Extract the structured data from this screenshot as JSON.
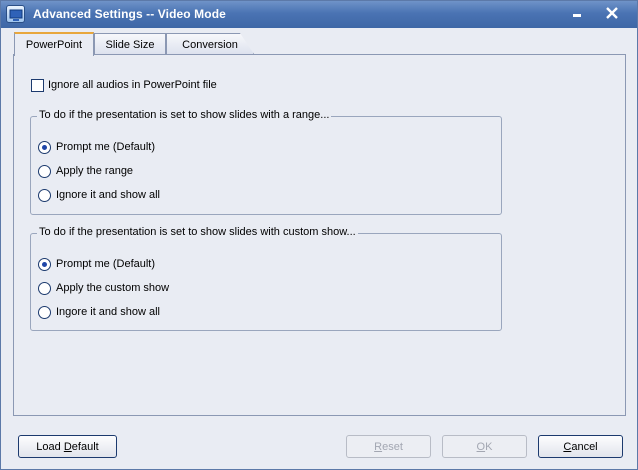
{
  "window": {
    "title": "Advanced Settings -- Video Mode"
  },
  "tabs": [
    {
      "label": "PowerPoint",
      "active": true
    },
    {
      "label": "Slide Size",
      "active": false
    },
    {
      "label": "Conversion",
      "active": false
    }
  ],
  "powerpoint": {
    "ignore_audio": {
      "label": "Ignore all audios in PowerPoint file",
      "checked": false
    },
    "range_group": {
      "legend": "To do if the presentation is set to show slides with a range...",
      "options": [
        {
          "label": "Prompt me (Default)",
          "selected": true
        },
        {
          "label": "Apply the range",
          "selected": false
        },
        {
          "label": "Ignore it and show all",
          "selected": false
        }
      ]
    },
    "custom_group": {
      "legend": "To do if the presentation is set to show slides with custom show...",
      "options": [
        {
          "label": "Prompt me (Default)",
          "selected": true
        },
        {
          "label": "Apply the custom show",
          "selected": false
        },
        {
          "label": "Ingore it and show all",
          "selected": false
        }
      ]
    }
  },
  "buttons": {
    "load_default": {
      "pre": "Load ",
      "accel": "D",
      "post": "efault"
    },
    "reset": {
      "accel": "R",
      "post": "eset",
      "enabled": false
    },
    "ok": {
      "accel": "O",
      "post": "K",
      "enabled": false
    },
    "cancel": {
      "accel": "C",
      "post": "ancel"
    }
  },
  "colors": {
    "titlebar": "#4a73b3",
    "window_bg": "#e9ecf3",
    "tab_accent": "#e8a73c",
    "radio_dot": "#1f46a8"
  }
}
